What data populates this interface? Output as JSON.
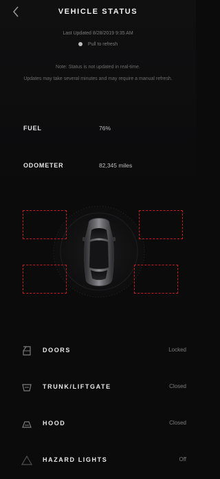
{
  "header": {
    "back_icon": "chevron-left-icon",
    "title": "VEHICLE STATUS"
  },
  "status": {
    "last_updated": "Last Updated 8/28/2019 9:35 AM",
    "pull_to_refresh": "Pull to refresh",
    "note_line1": "Note: Status is not updated in real-time.",
    "note_line2": "Updates may take several minutes and may require a manual refresh."
  },
  "metrics": {
    "fuel_label": "FUEL",
    "fuel_value": "76%",
    "odometer_label": "ODOMETER",
    "odometer_value": "82,345 miles"
  },
  "status_rows": [
    {
      "icon": "door-icon",
      "label": "DOORS",
      "value": "Locked"
    },
    {
      "icon": "trunk-icon",
      "label": "TRUNK/LIFTGATE",
      "value": "Closed"
    },
    {
      "icon": "hood-icon",
      "label": "HOOD",
      "value": "Closed"
    },
    {
      "icon": "hazard-icon",
      "label": "HAZARD LIGHTS",
      "value": "Off"
    }
  ],
  "colors": {
    "background": "#0b0b0c",
    "tire_alert": "#c51d1d",
    "text_primary": "#e8e8e8",
    "text_muted": "#7e7e7e"
  }
}
